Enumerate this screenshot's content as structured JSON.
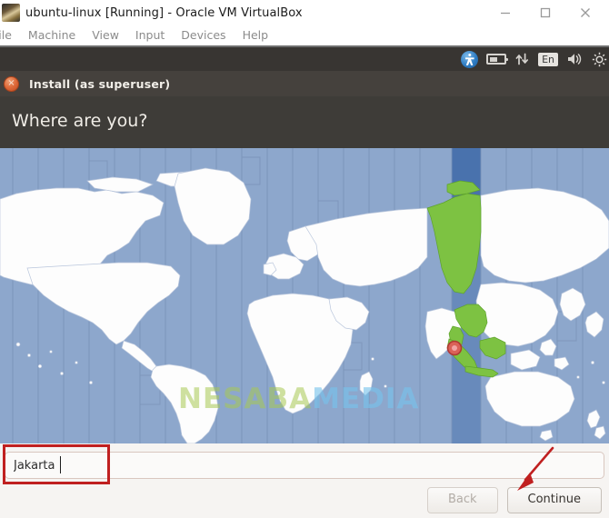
{
  "host_window": {
    "title": "ubuntu-linux [Running] - Oracle VM VirtualBox",
    "app_icon": "virtualbox-icon",
    "controls": {
      "minimize": "minimize-icon",
      "maximize": "maximize-icon",
      "close": "close-icon"
    },
    "menubar": [
      {
        "label": "File"
      },
      {
        "label": "Machine"
      },
      {
        "label": "View"
      },
      {
        "label": "Input"
      },
      {
        "label": "Devices"
      },
      {
        "label": "Help"
      }
    ]
  },
  "guest_panel": {
    "tray": [
      {
        "name": "accessibility-icon",
        "label": ""
      },
      {
        "name": "battery-icon",
        "label": ""
      },
      {
        "name": "network-icon",
        "label": ""
      },
      {
        "name": "keyboard-layout-indicator",
        "label": "En"
      },
      {
        "name": "volume-icon",
        "label": ""
      },
      {
        "name": "system-menu-icon",
        "label": ""
      }
    ]
  },
  "installer": {
    "window_title": "Install (as superuser)",
    "close_glyph": "×",
    "heading": "Where are you?",
    "location": {
      "value": "Jakarta",
      "placeholder": ""
    },
    "buttons": {
      "back": "Back",
      "continue": "Continue"
    }
  },
  "map": {
    "watermark_part1": "NESABA",
    "watermark_part2": "MEDIA",
    "marker_label": "Jakarta",
    "colors": {
      "ocean": "#8da7cc",
      "land": "#fdfdfd",
      "highlight_land": "#7dc242",
      "highlight_band": "#4a72ad",
      "marker": "#e25a5a"
    }
  },
  "annotations": {
    "input_highlight_color": "#c02020",
    "arrow_color": "#c02020"
  }
}
